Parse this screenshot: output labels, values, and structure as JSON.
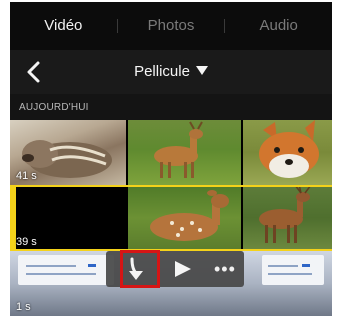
{
  "tabs": [
    {
      "label": "Vidéo",
      "active": true
    },
    {
      "label": "Photos",
      "active": false
    },
    {
      "label": "Audio",
      "active": false
    }
  ],
  "navbar": {
    "back_icon": "chevron-left-icon",
    "title": "Pellicule",
    "title_dropdown_icon": "triangle-down-icon"
  },
  "section": {
    "header": "AUJOURD'HUI"
  },
  "rows": [
    {
      "duration": "41 s",
      "thumbnails": [
        "boar-piglet-image",
        "deer-in-grass-image",
        "fox-face-image"
      ]
    },
    {
      "duration": "39 s",
      "selected": true,
      "thumbnails": [
        "black-clip-image",
        "fawn-image",
        "deer-standing-image"
      ]
    },
    {
      "duration": "1 s",
      "thumbnails": [
        "screenshot-image",
        "screenshot-image",
        "screenshot-image"
      ]
    }
  ],
  "toolbar": {
    "buttons": [
      {
        "name": "import",
        "icon": "down-arrow-icon"
      },
      {
        "name": "play",
        "icon": "play-icon"
      },
      {
        "name": "more",
        "icon": "more-dots-icon",
        "label": "•••"
      }
    ]
  },
  "colors": {
    "selection": "#f4d21a",
    "highlight": "#d61515",
    "background": "#000000"
  }
}
